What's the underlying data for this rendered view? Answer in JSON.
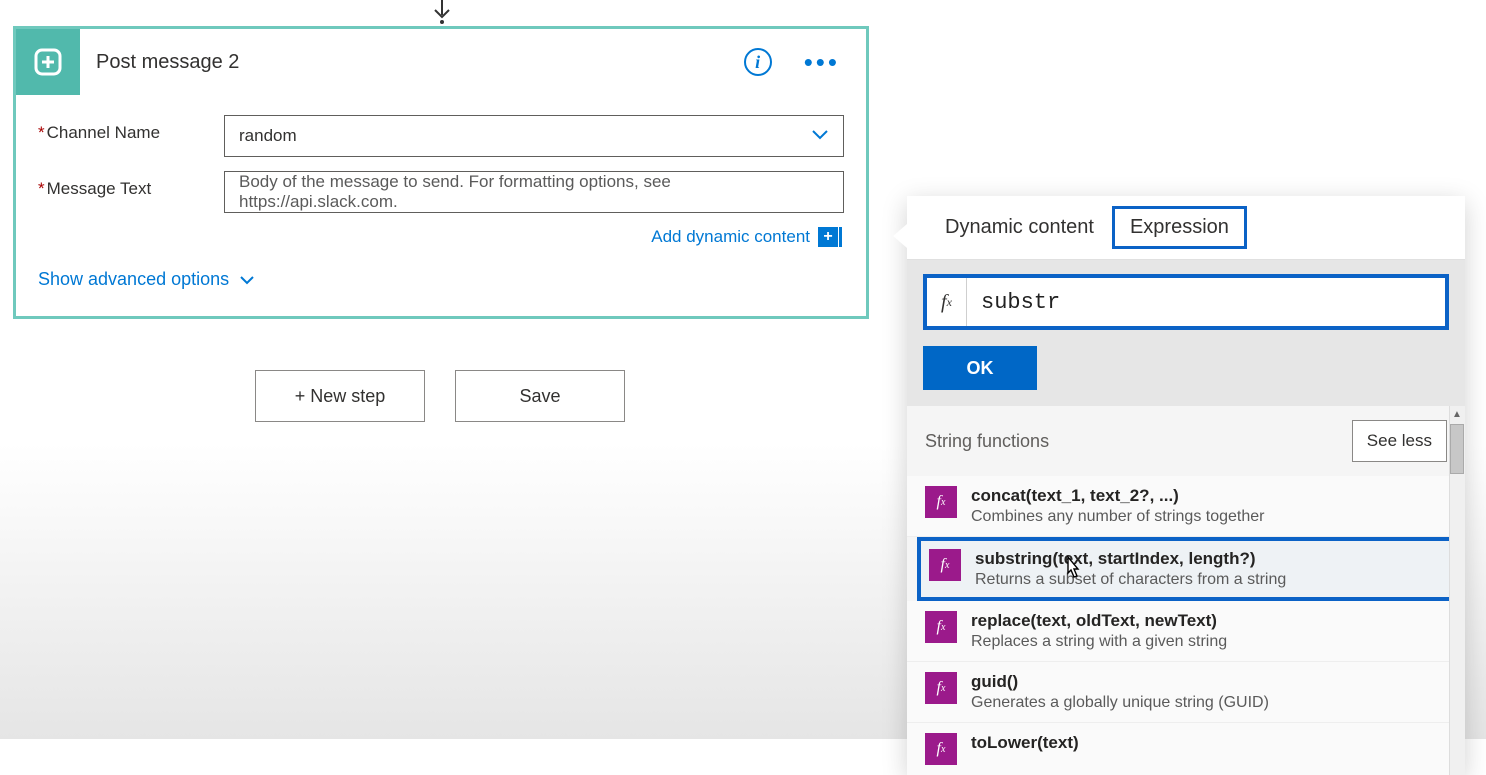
{
  "action": {
    "title": "Post message 2",
    "fields": {
      "channel": {
        "label": "Channel Name",
        "value": "random"
      },
      "message": {
        "label": "Message Text",
        "placeholder": "Body of the message to send. For formatting options, see https://api.slack.com."
      }
    },
    "add_dynamic": "Add dynamic content",
    "advanced": "Show advanced options"
  },
  "buttons": {
    "new_step": "+ New step",
    "save": "Save"
  },
  "panel": {
    "tabs": {
      "dynamic": "Dynamic content",
      "expression": "Expression"
    },
    "input_value": "substr",
    "ok": "OK",
    "section_title": "String functions",
    "see_less": "See less",
    "functions": [
      {
        "sig": "concat(text_1, text_2?, ...)",
        "desc": "Combines any number of strings together"
      },
      {
        "sig": "substring(text, startIndex, length?)",
        "desc": "Returns a subset of characters from a string"
      },
      {
        "sig": "replace(text, oldText, newText)",
        "desc": "Replaces a string with a given string"
      },
      {
        "sig": "guid()",
        "desc": "Generates a globally unique string (GUID)"
      },
      {
        "sig": "toLower(text)",
        "desc": ""
      }
    ]
  }
}
